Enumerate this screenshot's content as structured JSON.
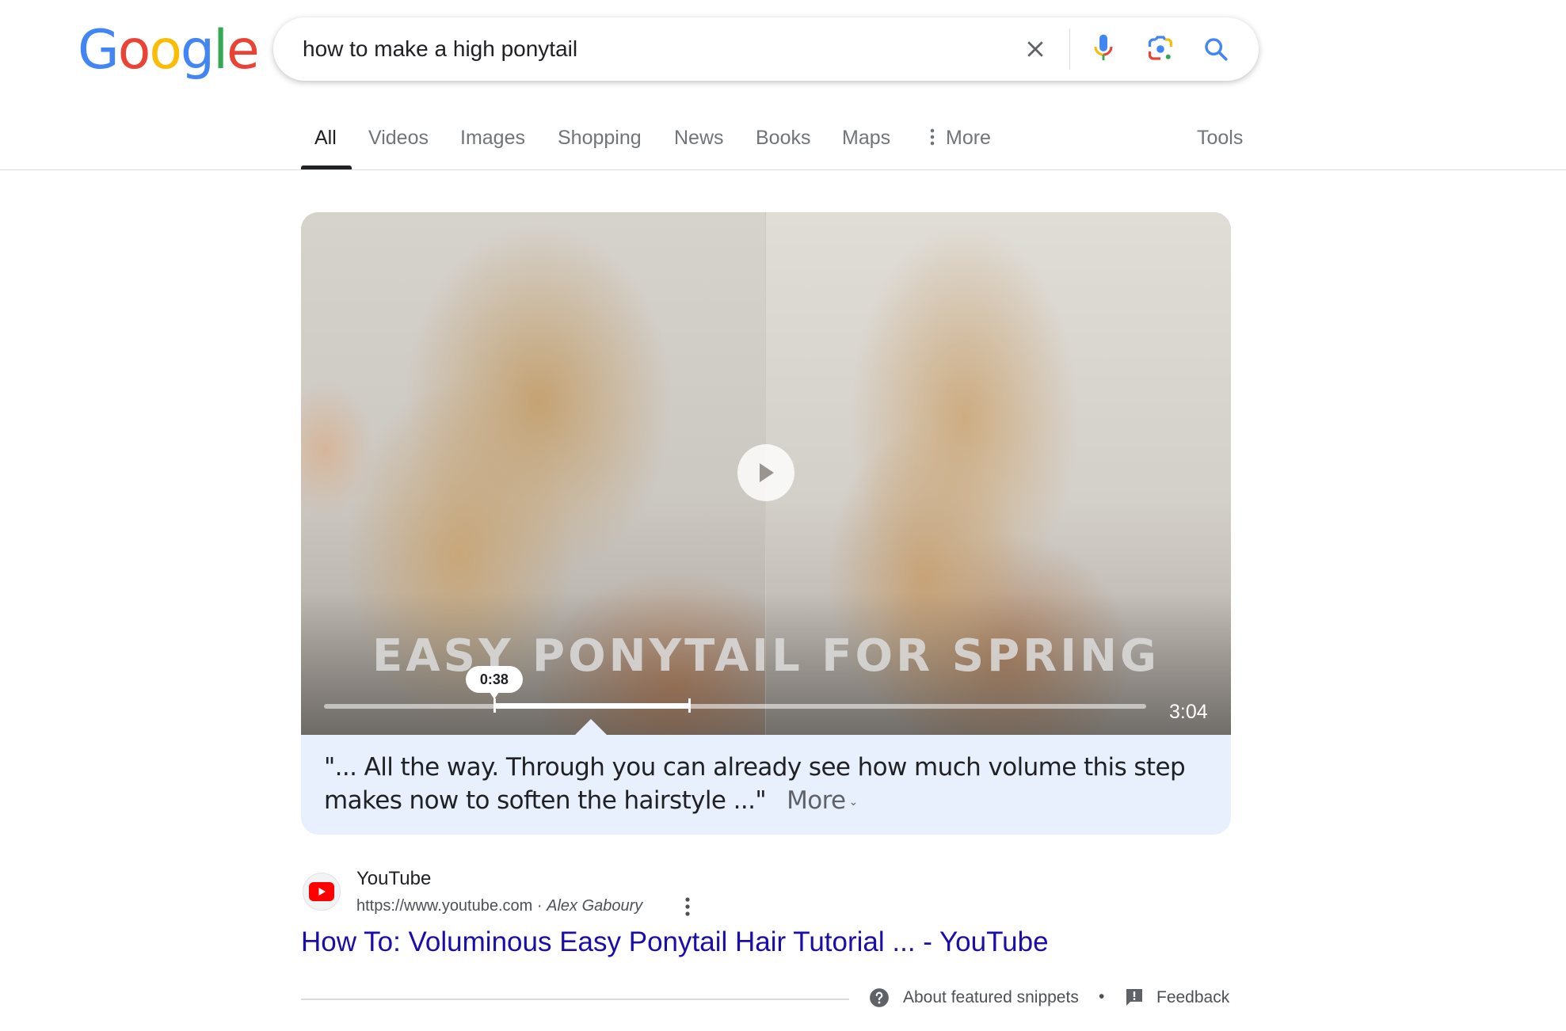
{
  "logo": {
    "letters": [
      {
        "ch": "G",
        "color": "#4285F4"
      },
      {
        "ch": "o",
        "color": "#EA4335"
      },
      {
        "ch": "o",
        "color": "#FBBC05"
      },
      {
        "ch": "g",
        "color": "#4285F4"
      },
      {
        "ch": "l",
        "color": "#34A853"
      },
      {
        "ch": "e",
        "color": "#EA4335"
      }
    ]
  },
  "search": {
    "value": "how to make a high ponytail",
    "icons": [
      "clear-icon",
      "microphone-icon",
      "google-lens-icon",
      "search-icon"
    ]
  },
  "tabs": {
    "items": [
      {
        "label": "All",
        "active": true
      },
      {
        "label": "Videos"
      },
      {
        "label": "Images"
      },
      {
        "label": "Shopping"
      },
      {
        "label": "News"
      },
      {
        "label": "Books"
      },
      {
        "label": "Maps"
      },
      {
        "label": "More"
      }
    ],
    "tools": "Tools"
  },
  "video": {
    "caption": "EASY PONYTAIL FOR SPRING",
    "clip_start": "0:38",
    "duration": "3:04",
    "clip_start_fraction": 0.207,
    "clip_end_fraction": 0.444
  },
  "snippet": {
    "text": "\"... All the way. Through you can already see how much volume this step makes now to soften the hairstyle ...\"",
    "more": "More"
  },
  "source": {
    "site_name": "YouTube",
    "url": "https://www.youtube.com",
    "separator": " · ",
    "author": "Alex Gaboury",
    "title": "How To: Voluminous Easy Ponytail Hair Tutorial ... - YouTube"
  },
  "footer": {
    "about": "About featured snippets",
    "dot": "•",
    "feedback": "Feedback"
  },
  "colors": {
    "link": "#1a0dab",
    "snippet_bg": "#e8f0fe",
    "youtube_red": "#FF0000"
  }
}
